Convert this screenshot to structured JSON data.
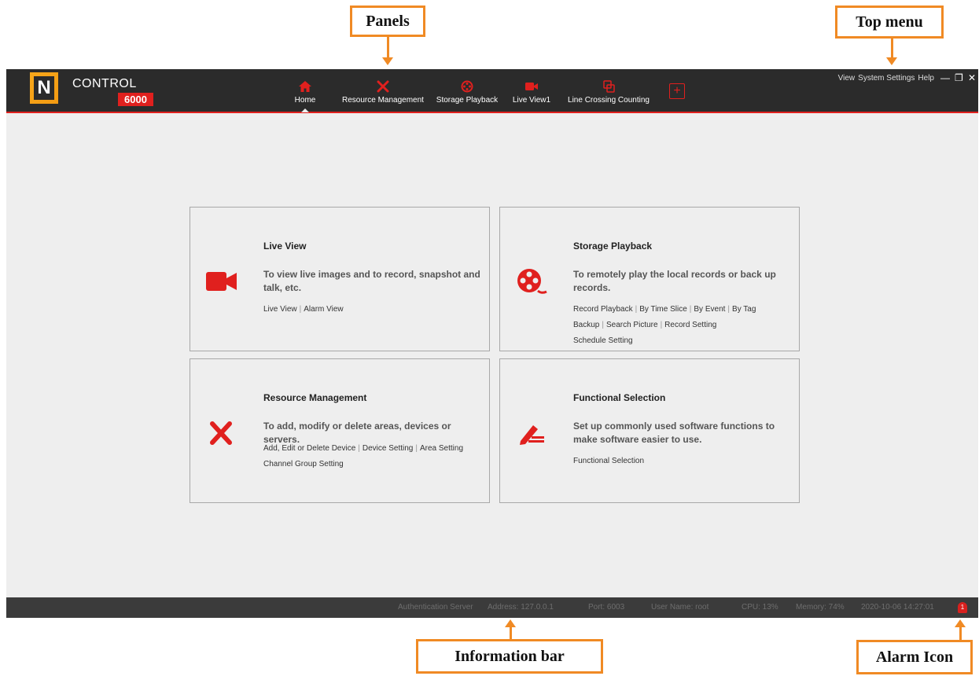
{
  "callouts": {
    "panels": "Panels",
    "top_menu": "Top menu",
    "information_bar": "Information bar",
    "alarm_icon": "Alarm Icon"
  },
  "logo": {
    "text": "CONTROL",
    "number": "6000",
    "letter": "N"
  },
  "tabs": [
    {
      "label": "Home",
      "icon": "home-icon",
      "active": true
    },
    {
      "label": "Resource Management",
      "icon": "tools-icon"
    },
    {
      "label": "Storage Playback",
      "icon": "film-reel-icon"
    },
    {
      "label": "Live View1",
      "icon": "video-camera-icon"
    },
    {
      "label": "Line Crossing Counting",
      "icon": "line-crossing-icon"
    }
  ],
  "add_tab": "+",
  "top_menu": {
    "view": "View",
    "system_settings": "System Settings",
    "help": "Help"
  },
  "window_controls": {
    "minimize": "—",
    "restore": "❐",
    "close": "✕"
  },
  "cards": {
    "live_view": {
      "title": "Live View",
      "desc": "To view live images and to record, snapshot and talk, etc.",
      "links": [
        "Live View",
        "Alarm View"
      ]
    },
    "storage_playback": {
      "title": "Storage Playback",
      "desc": "To remotely play the local records or back up records.",
      "links_row1": [
        "Record Playback",
        "By Time Slice",
        "By Event",
        "By Tag"
      ],
      "links_row2": [
        "Backup",
        "Search Picture",
        "Record Setting"
      ],
      "links_row3": [
        "Schedule Setting"
      ]
    },
    "resource_management": {
      "title": "Resource Management",
      "desc": "To add, modify or delete areas, devices or servers.",
      "links_row1": [
        "Add, Edit or Delete Device",
        "Device Setting",
        "Area Setting"
      ],
      "links_row2": [
        "Channel Group Setting"
      ]
    },
    "functional_selection": {
      "title": "Functional Selection",
      "desc": "Set up commonly used software functions to make software easier to use.",
      "links": [
        "Functional Selection"
      ]
    }
  },
  "statusbar": {
    "auth_server": "Authentication Server",
    "address": "Address: 127.0.0.1",
    "port": "Port: 6003",
    "user": "User Name: root",
    "cpu": "CPU: 13%",
    "memory": "Memory: 74%",
    "datetime": "2020-10-06 14:27:01",
    "alarm_count": "1"
  },
  "colors": {
    "accent": "#e0201e",
    "callout": "#f08a24",
    "topbar": "#2b2b2b",
    "logo_orange": "#f7a81b"
  }
}
